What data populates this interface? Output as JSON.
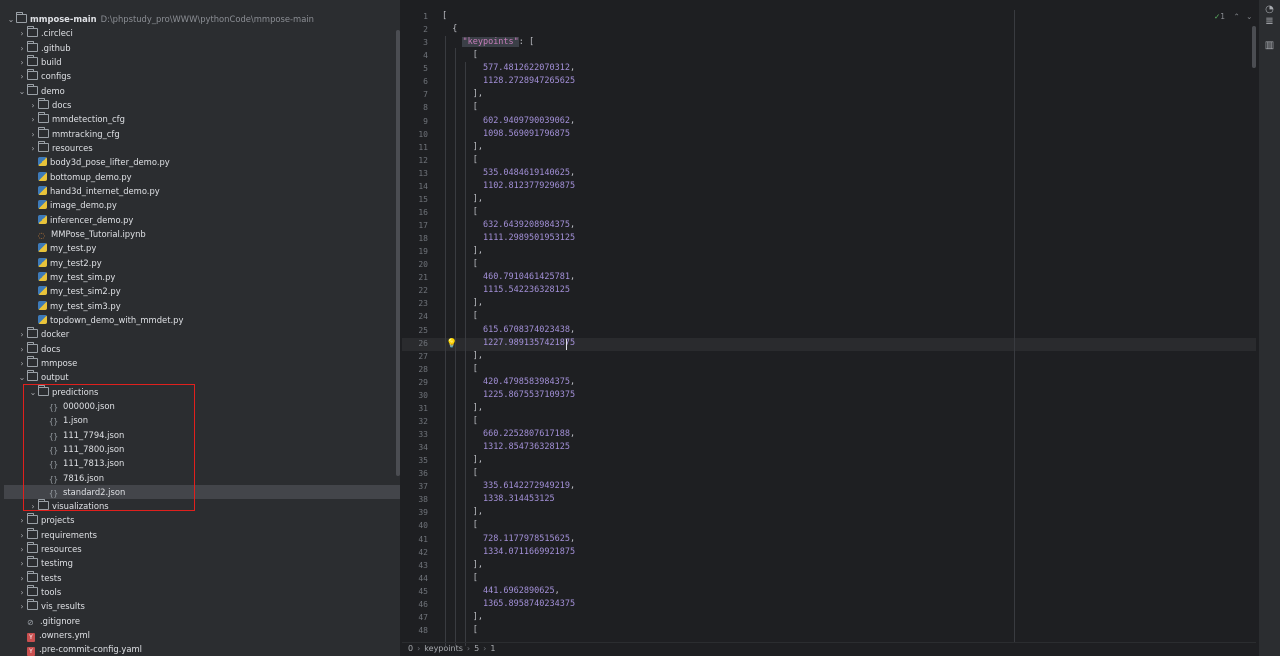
{
  "project": {
    "root_name": "mmpose-main",
    "root_path": "D:\\phpstudy_pro\\WWW\\pythonCode\\mmpose-main",
    "tree": [
      {
        "label": "mmpose-main",
        "depth": 0,
        "type": "folder",
        "expanded": true,
        "root": true
      },
      {
        "label": ".circleci",
        "depth": 1,
        "type": "folder",
        "expanded": false
      },
      {
        "label": ".github",
        "depth": 1,
        "type": "folder",
        "expanded": false
      },
      {
        "label": "build",
        "depth": 1,
        "type": "folder",
        "expanded": false
      },
      {
        "label": "configs",
        "depth": 1,
        "type": "folder",
        "expanded": false
      },
      {
        "label": "demo",
        "depth": 1,
        "type": "folder",
        "expanded": true
      },
      {
        "label": "docs",
        "depth": 2,
        "type": "folder",
        "expanded": false
      },
      {
        "label": "mmdetection_cfg",
        "depth": 2,
        "type": "folder",
        "expanded": false
      },
      {
        "label": "mmtracking_cfg",
        "depth": 2,
        "type": "folder",
        "expanded": false
      },
      {
        "label": "resources",
        "depth": 2,
        "type": "folder",
        "expanded": false
      },
      {
        "label": "body3d_pose_lifter_demo.py",
        "depth": 2,
        "type": "py"
      },
      {
        "label": "bottomup_demo.py",
        "depth": 2,
        "type": "py"
      },
      {
        "label": "hand3d_internet_demo.py",
        "depth": 2,
        "type": "py"
      },
      {
        "label": "image_demo.py",
        "depth": 2,
        "type": "py"
      },
      {
        "label": "inferencer_demo.py",
        "depth": 2,
        "type": "py"
      },
      {
        "label": "MMPose_Tutorial.ipynb",
        "depth": 2,
        "type": "ipynb"
      },
      {
        "label": "my_test.py",
        "depth": 2,
        "type": "py"
      },
      {
        "label": "my_test2.py",
        "depth": 2,
        "type": "py"
      },
      {
        "label": "my_test_sim.py",
        "depth": 2,
        "type": "py"
      },
      {
        "label": "my_test_sim2.py",
        "depth": 2,
        "type": "py"
      },
      {
        "label": "my_test_sim3.py",
        "depth": 2,
        "type": "py"
      },
      {
        "label": "topdown_demo_with_mmdet.py",
        "depth": 2,
        "type": "py"
      },
      {
        "label": "docker",
        "depth": 1,
        "type": "folder",
        "expanded": false
      },
      {
        "label": "docs",
        "depth": 1,
        "type": "folder",
        "expanded": false
      },
      {
        "label": "mmpose",
        "depth": 1,
        "type": "folder",
        "expanded": false
      },
      {
        "label": "output",
        "depth": 1,
        "type": "folder",
        "expanded": true
      },
      {
        "label": "predictions",
        "depth": 2,
        "type": "folder",
        "expanded": true
      },
      {
        "label": "000000.json",
        "depth": 3,
        "type": "json"
      },
      {
        "label": "1.json",
        "depth": 3,
        "type": "json"
      },
      {
        "label": "111_7794.json",
        "depth": 3,
        "type": "json"
      },
      {
        "label": "111_7800.json",
        "depth": 3,
        "type": "json"
      },
      {
        "label": "111_7813.json",
        "depth": 3,
        "type": "json"
      },
      {
        "label": "7816.json",
        "depth": 3,
        "type": "json"
      },
      {
        "label": "standard2.json",
        "depth": 3,
        "type": "json",
        "selected": true
      },
      {
        "label": "visualizations",
        "depth": 2,
        "type": "folder",
        "expanded": false
      },
      {
        "label": "projects",
        "depth": 1,
        "type": "folder",
        "expanded": false
      },
      {
        "label": "requirements",
        "depth": 1,
        "type": "folder",
        "expanded": false
      },
      {
        "label": "resources",
        "depth": 1,
        "type": "folder",
        "expanded": false
      },
      {
        "label": "testimg",
        "depth": 1,
        "type": "folder",
        "expanded": false
      },
      {
        "label": "tests",
        "depth": 1,
        "type": "folder",
        "expanded": false
      },
      {
        "label": "tools",
        "depth": 1,
        "type": "folder",
        "expanded": false
      },
      {
        "label": "vis_results",
        "depth": 1,
        "type": "folder",
        "expanded": false
      },
      {
        "label": ".gitignore",
        "depth": 1,
        "type": "ignore"
      },
      {
        "label": ".owners.yml",
        "depth": 1,
        "type": "yml"
      },
      {
        "label": ".pre-commit-config.yaml",
        "depth": 1,
        "type": "yml"
      }
    ]
  },
  "editor": {
    "active_file": "standard2.json",
    "inspection": "1",
    "lines": [
      [
        {
          "t": "p",
          "v": "["
        }
      ],
      [
        {
          "t": "p",
          "v": "  {"
        }
      ],
      [
        {
          "t": "p",
          "v": "    "
        },
        {
          "t": "keyhl",
          "v": "\"keypoints\""
        },
        {
          "t": "p",
          "v": ": ["
        }
      ],
      [
        {
          "t": "p",
          "v": "      ["
        }
      ],
      [
        {
          "t": "p",
          "v": "        "
        },
        {
          "t": "num",
          "v": "577.4812622070312"
        },
        {
          "t": "p",
          "v": ","
        }
      ],
      [
        {
          "t": "p",
          "v": "        "
        },
        {
          "t": "num",
          "v": "1128.2728947265625"
        }
      ],
      [
        {
          "t": "p",
          "v": "      ],"
        }
      ],
      [
        {
          "t": "p",
          "v": "      ["
        }
      ],
      [
        {
          "t": "p",
          "v": "        "
        },
        {
          "t": "num",
          "v": "602.9409790039062"
        },
        {
          "t": "p",
          "v": ","
        }
      ],
      [
        {
          "t": "p",
          "v": "        "
        },
        {
          "t": "num",
          "v": "1098.569091796875"
        }
      ],
      [
        {
          "t": "p",
          "v": "      ],"
        }
      ],
      [
        {
          "t": "p",
          "v": "      ["
        }
      ],
      [
        {
          "t": "p",
          "v": "        "
        },
        {
          "t": "num",
          "v": "535.0484619140625"
        },
        {
          "t": "p",
          "v": ","
        }
      ],
      [
        {
          "t": "p",
          "v": "        "
        },
        {
          "t": "num",
          "v": "1102.8123779296875"
        }
      ],
      [
        {
          "t": "p",
          "v": "      ],"
        }
      ],
      [
        {
          "t": "p",
          "v": "      ["
        }
      ],
      [
        {
          "t": "p",
          "v": "        "
        },
        {
          "t": "num",
          "v": "632.6439208984375"
        },
        {
          "t": "p",
          "v": ","
        }
      ],
      [
        {
          "t": "p",
          "v": "        "
        },
        {
          "t": "num",
          "v": "1111.2989501953125"
        }
      ],
      [
        {
          "t": "p",
          "v": "      ],"
        }
      ],
      [
        {
          "t": "p",
          "v": "      ["
        }
      ],
      [
        {
          "t": "p",
          "v": "        "
        },
        {
          "t": "num",
          "v": "460.7910461425781"
        },
        {
          "t": "p",
          "v": ","
        }
      ],
      [
        {
          "t": "p",
          "v": "        "
        },
        {
          "t": "num",
          "v": "1115.542236328125"
        }
      ],
      [
        {
          "t": "p",
          "v": "      ],"
        }
      ],
      [
        {
          "t": "p",
          "v": "      ["
        }
      ],
      [
        {
          "t": "p",
          "v": "        "
        },
        {
          "t": "num",
          "v": "615.6708374023438"
        },
        {
          "t": "p",
          "v": ","
        }
      ],
      [
        {
          "t": "p",
          "v": "        "
        },
        {
          "t": "num",
          "v": "1227.9891357421875"
        }
      ],
      [
        {
          "t": "p",
          "v": "      ],"
        }
      ],
      [
        {
          "t": "p",
          "v": "      ["
        }
      ],
      [
        {
          "t": "p",
          "v": "        "
        },
        {
          "t": "num",
          "v": "420.4798583984375"
        },
        {
          "t": "p",
          "v": ","
        }
      ],
      [
        {
          "t": "p",
          "v": "        "
        },
        {
          "t": "num",
          "v": "1225.8675537109375"
        }
      ],
      [
        {
          "t": "p",
          "v": "      ],"
        }
      ],
      [
        {
          "t": "p",
          "v": "      ["
        }
      ],
      [
        {
          "t": "p",
          "v": "        "
        },
        {
          "t": "num",
          "v": "660.2252807617188"
        },
        {
          "t": "p",
          "v": ","
        }
      ],
      [
        {
          "t": "p",
          "v": "        "
        },
        {
          "t": "num",
          "v": "1312.854736328125"
        }
      ],
      [
        {
          "t": "p",
          "v": "      ],"
        }
      ],
      [
        {
          "t": "p",
          "v": "      ["
        }
      ],
      [
        {
          "t": "p",
          "v": "        "
        },
        {
          "t": "num",
          "v": "335.6142272949219"
        },
        {
          "t": "p",
          "v": ","
        }
      ],
      [
        {
          "t": "p",
          "v": "        "
        },
        {
          "t": "num",
          "v": "1338.314453125"
        }
      ],
      [
        {
          "t": "p",
          "v": "      ],"
        }
      ],
      [
        {
          "t": "p",
          "v": "      ["
        }
      ],
      [
        {
          "t": "p",
          "v": "        "
        },
        {
          "t": "num",
          "v": "728.1177978515625"
        },
        {
          "t": "p",
          "v": ","
        }
      ],
      [
        {
          "t": "p",
          "v": "        "
        },
        {
          "t": "num",
          "v": "1334.0711669921875"
        }
      ],
      [
        {
          "t": "p",
          "v": "      ],"
        }
      ],
      [
        {
          "t": "p",
          "v": "      ["
        }
      ],
      [
        {
          "t": "p",
          "v": "        "
        },
        {
          "t": "num",
          "v": "441.6962890625"
        },
        {
          "t": "p",
          "v": ","
        }
      ],
      [
        {
          "t": "p",
          "v": "        "
        },
        {
          "t": "num",
          "v": "1365.8958740234375"
        }
      ],
      [
        {
          "t": "p",
          "v": "      ],"
        }
      ],
      [
        {
          "t": "p",
          "v": "      ["
        }
      ]
    ]
  },
  "breadcrumb": [
    "0",
    "keypoints",
    "5",
    "1"
  ],
  "colors": {
    "accent": "#3574f0",
    "highlight_box": "#e0201d",
    "number": "#a390d8",
    "key": "#c77dbb"
  }
}
